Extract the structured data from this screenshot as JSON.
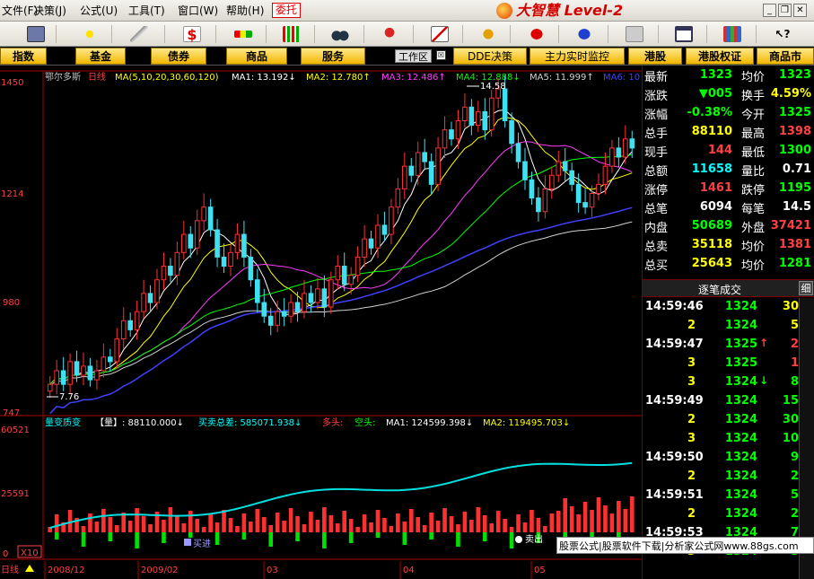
{
  "menubar": {
    "items": [
      "文件(F)",
      "决策(J)",
      "公式(U)",
      "工具(T)",
      "窗口(W)",
      "帮助(H)"
    ],
    "entrust": "委托",
    "app_title": "大智慧 Level-2"
  },
  "tabs": [
    "指数",
    "基金",
    "债券",
    "商品",
    "服务",
    "DDE决策",
    "主力实时监控",
    "港股",
    "港股权证",
    "商品市"
  ],
  "workzone": "工作区",
  "chart": {
    "stock_name": "鄂尔多斯",
    "period": "日线",
    "ma_label": "MA(5,10,20,30,60,120)",
    "ma": [
      {
        "name": "MA1:",
        "value": "13.192",
        "arrow": "↓",
        "color": "#ffffff"
      },
      {
        "name": "MA2:",
        "value": "12.780",
        "arrow": "↑",
        "color": "#ffff00"
      },
      {
        "name": "MA3:",
        "value": "12.486",
        "arrow": "↑",
        "color": "#ff3cff"
      },
      {
        "name": "MA4:",
        "value": "12.888",
        "arrow": "↓",
        "color": "#00ff00"
      },
      {
        "name": "MA5:",
        "value": "11.999",
        "arrow": "↑",
        "color": "#d0d0d0"
      },
      {
        "name": "MA6:",
        "value": "10",
        "arrow": "",
        "color": "#4040ff"
      }
    ],
    "price_axis": [
      "1450",
      "1214",
      "980",
      "747"
    ],
    "high_mark": "14.58",
    "low_mark": "7.76",
    "vol_title": "量变质变",
    "vol_indicator": "【量】: 88110.000↓",
    "vol_total": "买卖总差: 585071.938↓",
    "vol_long": "多头:",
    "vol_short": "空头:",
    "vol_ma1": "MA1: 124599.398↓",
    "vol_ma2": "MA2: 119495.703↓",
    "vol_axis": [
      "60521",
      "25591",
      "0"
    ],
    "vol_unit": "X10",
    "buy_label": "买进",
    "sell_label": "卖出",
    "dates": [
      "2008/12",
      "2009/02",
      "03",
      "04",
      "05"
    ],
    "bottom_label": "日线"
  },
  "quote": {
    "rows": [
      {
        "l1": "最新",
        "v1": "1323",
        "c1": "#00ff00",
        "l2": "均价",
        "v2": "1323",
        "c2": "#00ff00"
      },
      {
        "l1": "涨跌",
        "v1": "▼005",
        "c1": "#00ff00",
        "l2": "换手",
        "v2": "4.59%",
        "c2": "#ffff00"
      },
      {
        "l1": "涨幅",
        "v1": "-0.38%",
        "c1": "#00ff00",
        "l2": "今开",
        "v2": "1325",
        "c2": "#00ff00"
      },
      {
        "l1": "总手",
        "v1": "88110",
        "c1": "#ffff00",
        "l2": "最高",
        "v2": "1398",
        "c2": "#ff4040"
      },
      {
        "l1": "现手",
        "v1": "144",
        "c1": "#ff4040",
        "l2": "最低",
        "v2": "1300",
        "c2": "#00ff00"
      },
      {
        "l1": "总额",
        "v1": "11658",
        "c1": "#00ffff",
        "l2": "量比",
        "v2": "0.71",
        "c2": "#ffffff"
      },
      {
        "l1": "涨停",
        "v1": "1461",
        "c1": "#ff4040",
        "l2": "跌停",
        "v2": "1195",
        "c2": "#00ff00"
      },
      {
        "l1": "总笔",
        "v1": "6094",
        "c1": "#ffffff",
        "l2": "每笔",
        "v2": "14.5",
        "c2": "#ffffff"
      },
      {
        "l1": "内盘",
        "v1": "50689",
        "c1": "#00ff00",
        "l2": "外盘",
        "v2": "37421",
        "c2": "#ff4040"
      },
      {
        "l1": "总卖",
        "v1": "35118",
        "c1": "#ffff00",
        "l2": "均价",
        "v2": "1381",
        "c2": "#ff4040"
      },
      {
        "l1": "总买",
        "v1": "25643",
        "c1": "#ffff00",
        "l2": "均价",
        "v2": "1281",
        "c2": "#00ff00"
      }
    ],
    "trade_title": "逐笔成交",
    "trade_detail": "细",
    "trades": [
      {
        "time": "14:59:46",
        "price": "1324",
        "vol": "30",
        "arrow": "",
        "pc": "#00ff00",
        "vc": "#ffff00"
      },
      {
        "time": "2",
        "price": "1324",
        "vol": "5",
        "arrow": "",
        "pc": "#00ff00",
        "vc": "#ffff00"
      },
      {
        "time": "14:59:47",
        "price": "1325",
        "vol": "2",
        "arrow": "↑",
        "pc": "#00ff00",
        "vc": "#ff4040"
      },
      {
        "time": "3",
        "price": "1325",
        "vol": "1",
        "arrow": "",
        "pc": "#00ff00",
        "vc": "#ff4040"
      },
      {
        "time": "3",
        "price": "1324",
        "vol": "8",
        "arrow": "↓",
        "pc": "#00ff00",
        "vc": "#00ff00"
      },
      {
        "time": "14:59:49",
        "price": "1324",
        "vol": "15",
        "arrow": "",
        "pc": "#00ff00",
        "vc": "#00ff00"
      },
      {
        "time": "2",
        "price": "1324",
        "vol": "30",
        "arrow": "",
        "pc": "#00ff00",
        "vc": "#00ff00"
      },
      {
        "time": "3",
        "price": "1324",
        "vol": "10",
        "arrow": "",
        "pc": "#00ff00",
        "vc": "#00ff00"
      },
      {
        "time": "14:59:50",
        "price": "1324",
        "vol": "9",
        "arrow": "",
        "pc": "#00ff00",
        "vc": "#00ff00"
      },
      {
        "time": "2",
        "price": "1324",
        "vol": "2",
        "arrow": "",
        "pc": "#00ff00",
        "vc": "#00ff00"
      },
      {
        "time": "14:59:51",
        "price": "1324",
        "vol": "5",
        "arrow": "",
        "pc": "#00ff00",
        "vc": "#00ff00"
      },
      {
        "time": "2",
        "price": "1324",
        "vol": "2",
        "arrow": "",
        "pc": "#00ff00",
        "vc": "#00ff00"
      },
      {
        "time": "14:59:53",
        "price": "1324",
        "vol": "7",
        "arrow": "",
        "pc": "#00ff00",
        "vc": "#00ff00"
      },
      {
        "time": "3",
        "price": "1324",
        "vol": "5",
        "arrow": "",
        "pc": "#00ff00",
        "vc": "#00ff00"
      }
    ]
  },
  "watermark": "股票公式|股票软件下载|分析家公式网www.88gs.com",
  "chart_data": {
    "type": "candlestick",
    "ylim": [
      7.47,
      14.58
    ],
    "price_ticks": [
      14.5,
      12.14,
      9.8,
      7.47
    ],
    "close": [
      8.0,
      8.3,
      8.0,
      8.5,
      8.2,
      8.4,
      8.1,
      8.3,
      8.6,
      8.5,
      9.0,
      9.4,
      9.2,
      9.6,
      10.0,
      9.8,
      10.3,
      10.6,
      10.4,
      10.9,
      11.3,
      11.0,
      11.6,
      11.9,
      11.4,
      10.8,
      10.6,
      10.9,
      11.3,
      10.8,
      10.3,
      9.8,
      9.5,
      9.3,
      9.6,
      9.5,
      9.8,
      9.6,
      10.0,
      9.8,
      10.1,
      9.7,
      10.3,
      10.6,
      10.2,
      10.4,
      10.8,
      11.2,
      11.0,
      11.5,
      11.3,
      11.9,
      12.3,
      12.8,
      12.6,
      13.1,
      12.9,
      12.4,
      13.2,
      13.6,
      13.4,
      13.8,
      14.1,
      13.7,
      14.0,
      13.6,
      14.3,
      14.5,
      13.8,
      13.3,
      12.9,
      12.5,
      12.1,
      11.8,
      12.3,
      12.6,
      12.9,
      12.7,
      12.4,
      12.0,
      11.9,
      12.2,
      12.4,
      12.8,
      13.2,
      13.0,
      13.4,
      13.2
    ]
  }
}
